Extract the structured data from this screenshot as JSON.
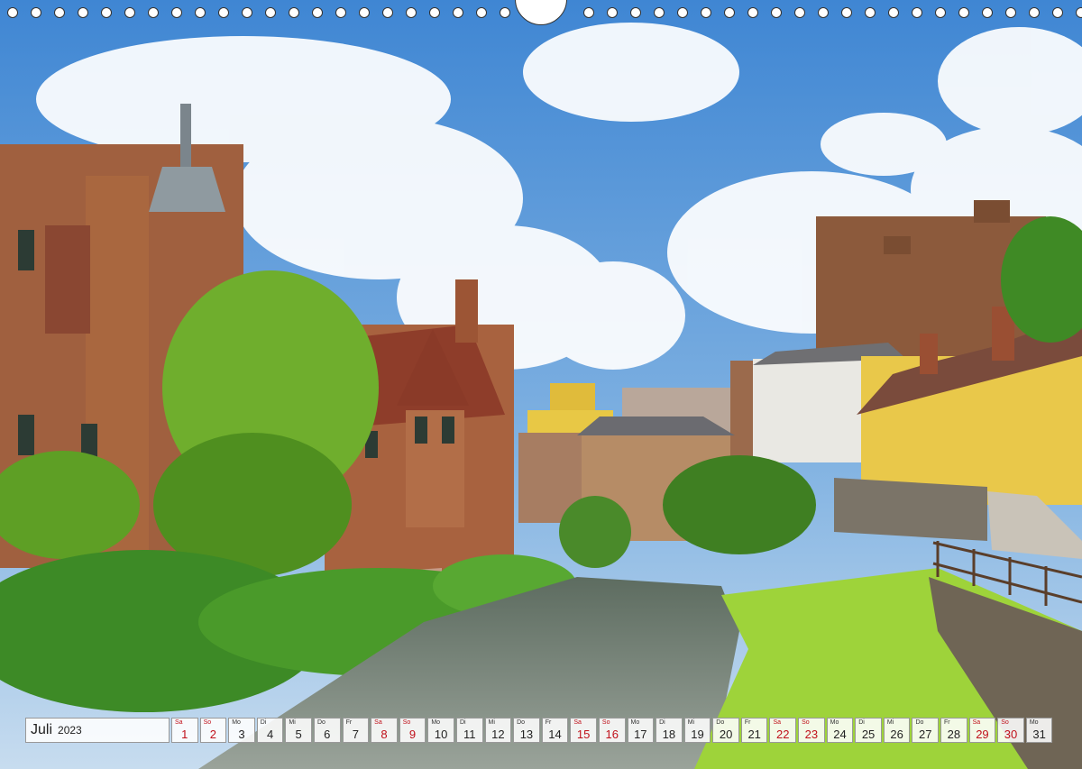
{
  "calendar": {
    "month": "Juli",
    "year": "2023",
    "days": [
      {
        "wd": "Sa",
        "d": "1",
        "weekend": true
      },
      {
        "wd": "So",
        "d": "2",
        "weekend": true
      },
      {
        "wd": "Mo",
        "d": "3",
        "weekend": false
      },
      {
        "wd": "Di",
        "d": "4",
        "weekend": false
      },
      {
        "wd": "Mi",
        "d": "5",
        "weekend": false
      },
      {
        "wd": "Do",
        "d": "6",
        "weekend": false
      },
      {
        "wd": "Fr",
        "d": "7",
        "weekend": false
      },
      {
        "wd": "Sa",
        "d": "8",
        "weekend": true
      },
      {
        "wd": "So",
        "d": "9",
        "weekend": true
      },
      {
        "wd": "Mo",
        "d": "10",
        "weekend": false
      },
      {
        "wd": "Di",
        "d": "11",
        "weekend": false
      },
      {
        "wd": "Mi",
        "d": "12",
        "weekend": false
      },
      {
        "wd": "Do",
        "d": "13",
        "weekend": false
      },
      {
        "wd": "Fr",
        "d": "14",
        "weekend": false
      },
      {
        "wd": "Sa",
        "d": "15",
        "weekend": true
      },
      {
        "wd": "So",
        "d": "16",
        "weekend": true
      },
      {
        "wd": "Mo",
        "d": "17",
        "weekend": false
      },
      {
        "wd": "Di",
        "d": "18",
        "weekend": false
      },
      {
        "wd": "Mi",
        "d": "19",
        "weekend": false
      },
      {
        "wd": "Do",
        "d": "20",
        "weekend": false
      },
      {
        "wd": "Fr",
        "d": "21",
        "weekend": false
      },
      {
        "wd": "Sa",
        "d": "22",
        "weekend": true
      },
      {
        "wd": "So",
        "d": "23",
        "weekend": true
      },
      {
        "wd": "Mo",
        "d": "24",
        "weekend": false
      },
      {
        "wd": "Di",
        "d": "25",
        "weekend": false
      },
      {
        "wd": "Mi",
        "d": "26",
        "weekend": false
      },
      {
        "wd": "Do",
        "d": "27",
        "weekend": false
      },
      {
        "wd": "Fr",
        "d": "28",
        "weekend": false
      },
      {
        "wd": "Sa",
        "d": "29",
        "weekend": true
      },
      {
        "wd": "So",
        "d": "30",
        "weekend": true
      },
      {
        "wd": "Mo",
        "d": "31",
        "weekend": false
      }
    ]
  },
  "colors": {
    "sky": "#5f98d6",
    "weekend": "#c0101a",
    "stone": "#a2664a",
    "yellow_house": "#e8c845",
    "grass": "#9ed33a",
    "river": "#7c8378"
  }
}
